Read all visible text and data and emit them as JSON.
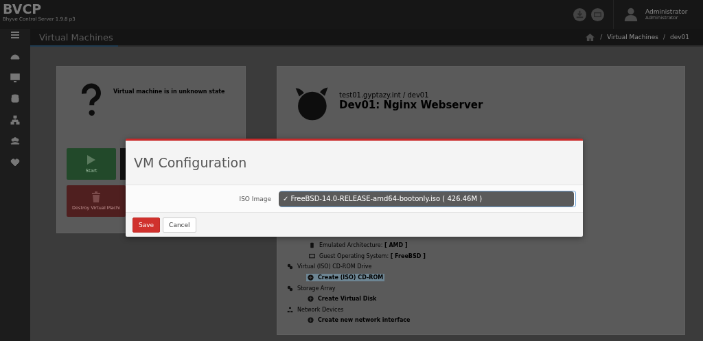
{
  "brand": {
    "name": "BVCP",
    "version": "Bhyve Control Server 1.9.8 p3"
  },
  "user": {
    "name": "Administrator",
    "role": "Administrator"
  },
  "page_title": "Virtual Machines",
  "breadcrumb": [
    {
      "text": "/",
      "kind": "separator"
    },
    {
      "text": "Virtual Machines",
      "kind": "link"
    },
    {
      "text": "/",
      "kind": "separator"
    },
    {
      "text": "dev01",
      "kind": "current"
    }
  ],
  "status_card": {
    "message": "Virtual machine is in unknown state",
    "buttons": [
      {
        "label": "Start",
        "kind": "start"
      },
      {
        "label": "Destroy Virtual Machi",
        "kind": "destroy"
      }
    ]
  },
  "vm": {
    "path": "test01.gyptazy.int / dev01",
    "title": "Dev01: Nginx Webserver"
  },
  "option_rows": [
    {
      "label": "Emulated Architecture:",
      "value": "[ AMD ]"
    },
    {
      "label": "Guest Operating System:",
      "value": "[ FreeBSD ]"
    }
  ],
  "tree": [
    {
      "label": "Virtual (ISO) CD-ROM Drive",
      "children": [
        {
          "label": "Create (ISO) CD-ROM",
          "selected": true
        }
      ]
    },
    {
      "label": "Storage Array",
      "children": [
        {
          "label": "Create Virtual Disk",
          "selected": false
        }
      ]
    },
    {
      "label": "Network Devices",
      "children": [
        {
          "label": "Create new network interface",
          "selected": false
        }
      ]
    }
  ],
  "modal": {
    "title": "VM Configuration",
    "field_label": "ISO Image",
    "options": [
      {
        "label": "FreeBSD-14.0-RELEASE-amd64-bootonly.iso ( 426.46M )",
        "mark": "✓",
        "selected": true
      }
    ],
    "buttons": [
      {
        "label": "Save",
        "kind": "primary"
      },
      {
        "label": "Cancel",
        "kind": "default"
      }
    ]
  }
}
